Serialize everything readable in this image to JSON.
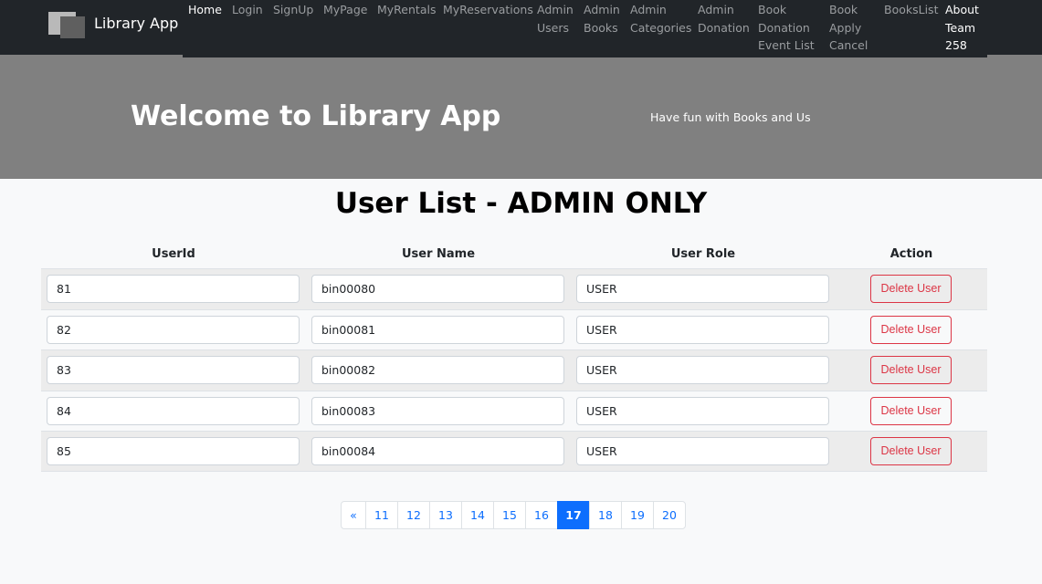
{
  "navbar": {
    "brand": "Library App",
    "items": [
      {
        "label": "Home",
        "active": true
      },
      {
        "label": "Login"
      },
      {
        "label": "SignUp"
      },
      {
        "label": "MyPage"
      },
      {
        "label": "MyRentals"
      },
      {
        "label": "MyReservations"
      },
      {
        "label": "Admin\nUsers"
      },
      {
        "label": "Admin\nBooks"
      },
      {
        "label": "Admin\nCategories"
      },
      {
        "label": "Admin\nDonation"
      },
      {
        "label": "Book\nDonation\nEvent List"
      },
      {
        "label": "Book\nApply\nCancel"
      },
      {
        "label": "BooksList"
      },
      {
        "label": "About\nTeam\n258",
        "active": true
      }
    ]
  },
  "banner": {
    "title": "Welcome to Library App",
    "subtitle": "Have fun with Books and Us"
  },
  "page": {
    "title": "User List - ADMIN ONLY"
  },
  "table": {
    "headers": [
      "UserId",
      "User Name",
      "User Role",
      "Action"
    ],
    "rows": [
      {
        "id": "81",
        "name": "bin00080",
        "role": "USER",
        "action": "Delete User"
      },
      {
        "id": "82",
        "name": "bin00081",
        "role": "USER",
        "action": "Delete User"
      },
      {
        "id": "83",
        "name": "bin00082",
        "role": "USER",
        "action": "Delete User"
      },
      {
        "id": "84",
        "name": "bin00083",
        "role": "USER",
        "action": "Delete User"
      },
      {
        "id": "85",
        "name": "bin00084",
        "role": "USER",
        "action": "Delete User"
      }
    ]
  },
  "pagination": {
    "prev": "«",
    "pages": [
      "11",
      "12",
      "13",
      "14",
      "15",
      "16",
      "17",
      "18",
      "19",
      "20"
    ],
    "current": "17"
  },
  "colors": {
    "navbar": "#212529",
    "banner": "#808080",
    "primary": "#0d6efd",
    "danger": "#dc3545"
  }
}
